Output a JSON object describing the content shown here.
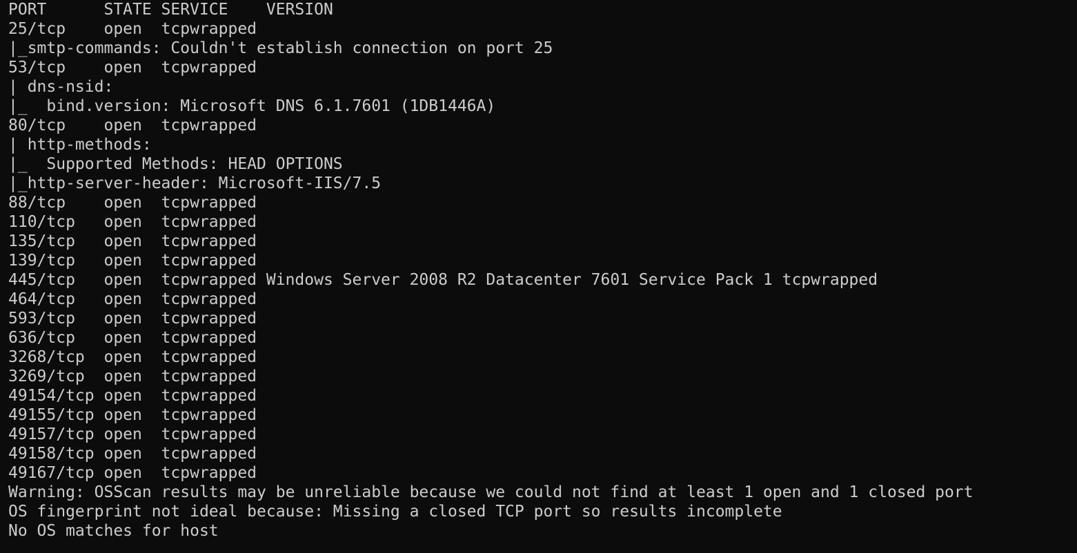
{
  "terminal": {
    "lines": [
      "PORT      STATE SERVICE    VERSION",
      "25/tcp    open  tcpwrapped",
      "|_smtp-commands: Couldn't establish connection on port 25",
      "53/tcp    open  tcpwrapped",
      "| dns-nsid:",
      "|_  bind.version: Microsoft DNS 6.1.7601 (1DB1446A)",
      "80/tcp    open  tcpwrapped",
      "| http-methods:",
      "|_  Supported Methods: HEAD OPTIONS",
      "|_http-server-header: Microsoft-IIS/7.5",
      "88/tcp    open  tcpwrapped",
      "110/tcp   open  tcpwrapped",
      "135/tcp   open  tcpwrapped",
      "139/tcp   open  tcpwrapped",
      "445/tcp   open  tcpwrapped Windows Server 2008 R2 Datacenter 7601 Service Pack 1 tcpwrapped",
      "464/tcp   open  tcpwrapped",
      "593/tcp   open  tcpwrapped",
      "636/tcp   open  tcpwrapped",
      "3268/tcp  open  tcpwrapped",
      "3269/tcp  open  tcpwrapped",
      "49154/tcp open  tcpwrapped",
      "49155/tcp open  tcpwrapped",
      "49157/tcp open  tcpwrapped",
      "49158/tcp open  tcpwrapped",
      "49167/tcp open  tcpwrapped",
      "Warning: OSScan results may be unreliable because we could not find at least 1 open and 1 closed port",
      "OS fingerprint not ideal because: Missing a closed TCP port so results incomplete",
      "No OS matches for host"
    ],
    "colors": {
      "background": "#0c0c0c",
      "foreground": "#cccccc"
    }
  }
}
